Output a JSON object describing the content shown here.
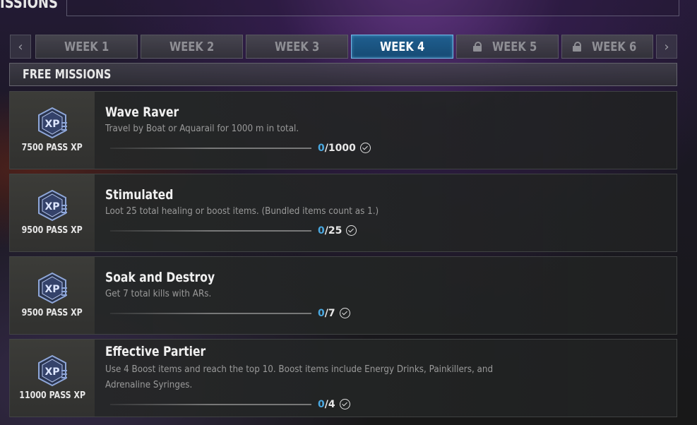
{
  "header": {
    "title": "ISSIONS"
  },
  "tabs": {
    "prev_arrow": "‹",
    "next_arrow": "›",
    "items": [
      {
        "label": "WEEK 1",
        "locked": false,
        "active": false
      },
      {
        "label": "WEEK 2",
        "locked": false,
        "active": false
      },
      {
        "label": "WEEK 3",
        "locked": false,
        "active": false
      },
      {
        "label": "WEEK 4",
        "locked": false,
        "active": true
      },
      {
        "label": "WEEK 5",
        "locked": true,
        "active": false
      },
      {
        "label": "WEEK 6",
        "locked": true,
        "active": false
      }
    ]
  },
  "section": {
    "title": "FREE MISSIONS"
  },
  "missions": [
    {
      "reward": "7500 PASS XP",
      "title": "Wave Raver",
      "description": "Travel by Boat or Aquarail for 1000 m in total.",
      "current": "0",
      "total": "/1000"
    },
    {
      "reward": "9500 PASS XP",
      "title": "Stimulated",
      "description": "Loot 25 total healing or boost items. (Bundled items count as 1.)",
      "current": "0",
      "total": "/25"
    },
    {
      "reward": "9500 PASS XP",
      "title": "Soak and Destroy",
      "description": "Get 7 total kills with ARs.",
      "current": "0",
      "total": "/7"
    },
    {
      "reward": "11000 PASS XP",
      "title": "Effective Partier",
      "description": "Use 4 Boost items and reach the top 10. Boost items include Energy Drinks, Painkillers, and Adrenaline Syringes.",
      "current": "0",
      "total": "/4"
    }
  ],
  "icons": {
    "xp_badge": "xp-badge-icon",
    "lock": "lock-icon",
    "check": "check-circle-icon"
  },
  "colors": {
    "active_tab": "#1f5f90",
    "active_border": "#6fb8e6",
    "progress_current": "#4aa8e0"
  }
}
